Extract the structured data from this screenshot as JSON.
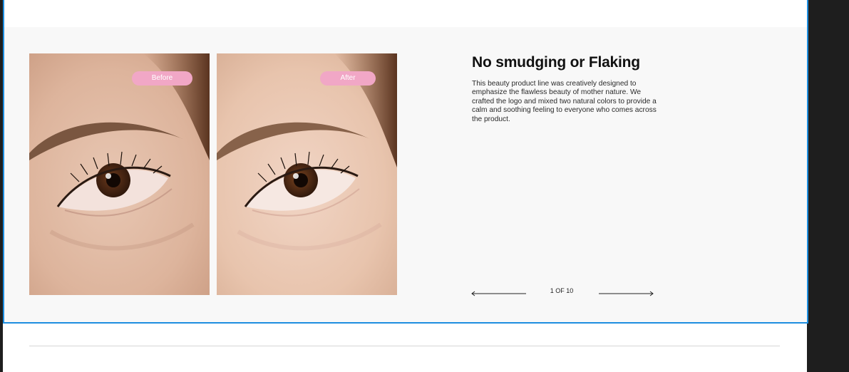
{
  "slide": {
    "before_label": "Before",
    "after_label": "After",
    "title": "No smudging or Flaking",
    "description": "This beauty product line was creatively designed to emphasize the flawless beauty of mother nature. We crafted the logo and mixed two natural colors to provide a calm and soothing feeling to everyone who comes across the product.",
    "counter": "1 OF 10"
  },
  "colors": {
    "accent_pink": "#f1a7c6",
    "selection_blue": "#1d8ee0",
    "section_background": "#f8f8f8"
  },
  "icons": [
    "arrow-left-icon",
    "arrow-right-icon"
  ]
}
